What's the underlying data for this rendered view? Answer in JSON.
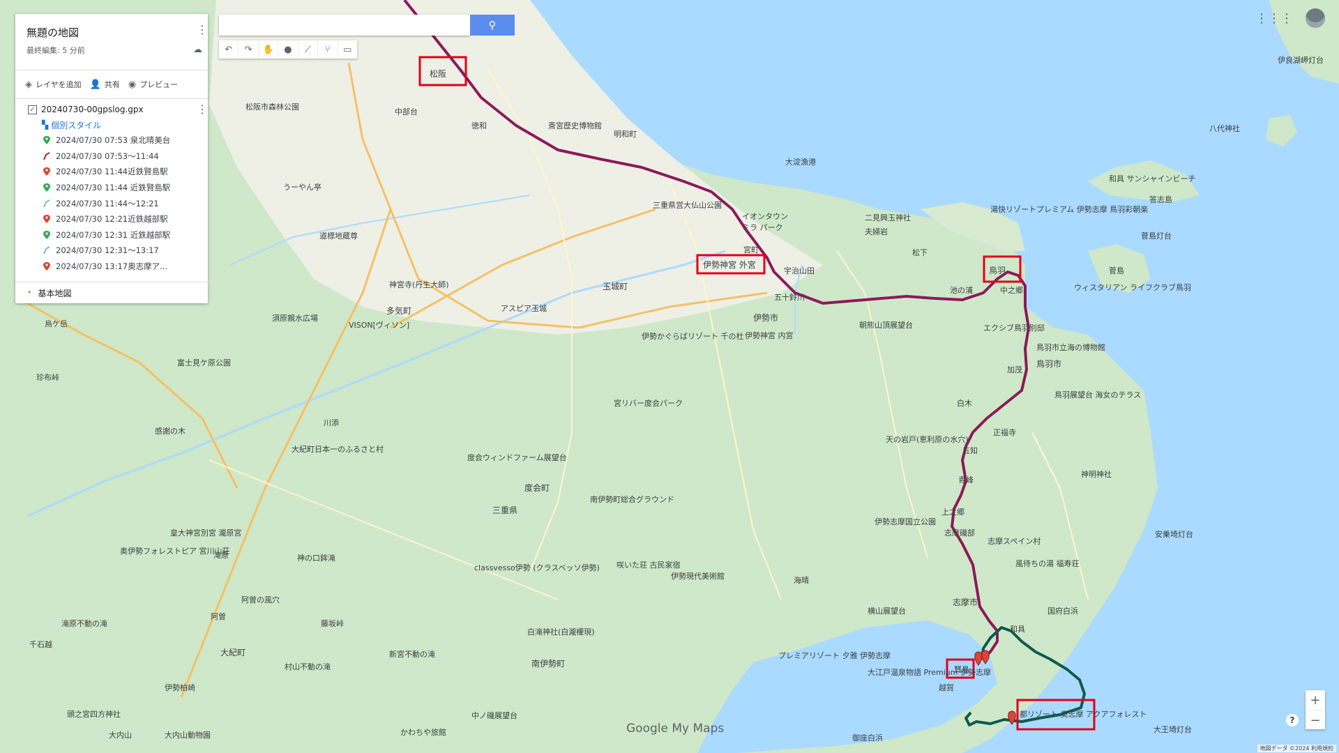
{
  "panel": {
    "title": "無題の地図",
    "subtitle": "最終編集: 5 分前",
    "actions": {
      "add_layer": "レイヤを追加",
      "share": "共有",
      "preview": "プレビュー"
    },
    "layer": {
      "name": "20240730-00gpslog.gpx",
      "style": "個別スタイル",
      "items": [
        {
          "label": "2024/07/30 07:53 泉北晴美台",
          "kind": "point",
          "color": "#34a853"
        },
        {
          "label": "2024/07/30 07:53〜11:44",
          "kind": "line",
          "color": "#a52714"
        },
        {
          "label": "2024/07/30 11:44近鉄賢島駅",
          "kind": "point",
          "color": "#db4437"
        },
        {
          "label": "2024/07/30 11:44 近鉄賢島駅",
          "kind": "point",
          "color": "#34a853"
        },
        {
          "label": "2024/07/30 11:44〜12:21",
          "kind": "line",
          "color": "#7cb4f0"
        },
        {
          "label": "2024/07/30 12:21近鉄越部駅",
          "kind": "point",
          "color": "#db4437"
        },
        {
          "label": "2024/07/30 12:31 近鉄越部駅",
          "kind": "point",
          "color": "#34a853"
        },
        {
          "label": "2024/07/30 12:31〜13:17",
          "kind": "line",
          "color": "#7cb4f0"
        },
        {
          "label": "2024/07/30 13:17奥志摩ア...",
          "kind": "point",
          "color": "#db4437"
        }
      ]
    },
    "base_map": "基本地図"
  },
  "map": {
    "highlight_labels": [
      "松阪",
      "伊勢神宮 外宮",
      "鳥羽",
      "賢島",
      "都リゾート 奥志摩 アクアフォレスト"
    ],
    "places": [
      "松阪",
      "明和町",
      "斎宮歴史博物館",
      "大淀漁港",
      "三重県営大仏山公園",
      "イオンタウン",
      "ミラ パーク",
      "宮町",
      "伊勢市",
      "五十鈴川",
      "伊勢神宮 内宮",
      "玉城町",
      "アスピア玉城",
      "多気町",
      "神宮寺(丹生大師)",
      "VISON[ヴィソン]",
      "須原親水広場",
      "道標地蔵尊",
      "松阪市森林公園",
      "中部台",
      "徳和",
      "うーやん亭",
      "宮リバー度会パーク",
      "度会町",
      "度会ウィンドファーム展望台",
      "三重県",
      "大紀町日本一のふるさと村",
      "川添",
      "感謝の木",
      "富士見ケ原公園",
      "珍布峠",
      "烏ケ岳",
      "奥伊勢フォレストピア 宮川山荘",
      "皇大神宮別宮 瀧原宮",
      "滝原",
      "阿曽",
      "神の口鉾滝",
      "阿曽の風穴",
      "藤坂峠",
      "大紀町",
      "千石越",
      "伊勢柏崎",
      "頭之宮四方神社",
      "大内山",
      "大内山動物園",
      "滝原不動の滝",
      "村山不動の滝",
      "新宮不動の滝",
      "南伊勢町",
      "白滝神社(白瀧權現)",
      "南伊勢町総合グラウンド",
      "伊勢現代美術館",
      "咲いた荘 古民家宿",
      "classvesso伊勢 (クラスベッソ伊勢)",
      "かわちや旅館",
      "中ノ磯展望台",
      "伊勢志摩国立公園",
      "海晴",
      "横山展望台",
      "志摩市",
      "プレミアリゾート 夕雅 伊勢志摩",
      "大江戸温泉物語 Premium 伊勢志摩",
      "賢島",
      "志摩スペイン村",
      "風待ちの湯 福寿荘",
      "国府白浜",
      "大王埼灯台",
      "安乗埼灯台",
      "神明神社",
      "鳥羽展望台 海女のテラス",
      "正福寺",
      "天の岩戸(恵利原の水穴)",
      "鳥羽市",
      "鳥羽市立海の博物館",
      "エクシブ鳥羽別邸",
      "ウィスタリアン ライフクラブ鳥羽",
      "湯快リゾートプレミアム 伊勢志摩 鳥羽彩朝楽",
      "菅島",
      "菅島灯台",
      "答志島",
      "和具 サンシャインビーチ",
      "八代神社",
      "伊良湖岬灯台",
      "二見興玉神社",
      "夫婦岩",
      "朝熊山頂展望台",
      "伊勢かぐらばリゾート 千の杜",
      "宇治山田",
      "松下",
      "池の浦",
      "中之郷",
      "加茂",
      "白木",
      "五知",
      "青峰",
      "上之郷",
      "志摩磯部",
      "御座白浜",
      "和具",
      "越賀"
    ],
    "route_colors": {
      "train": "#8b1a5a",
      "bike": "#0f5a4e"
    }
  },
  "search": {
    "placeholder": ""
  },
  "toolbar": {
    "tools": [
      "undo-icon",
      "redo-icon",
      "hand-icon",
      "marker-icon",
      "line-icon",
      "route-icon",
      "ruler-icon"
    ]
  },
  "branding": {
    "logo": "Google My Maps",
    "attribution": "地図データ ©2024   利用規約"
  },
  "zoom": {
    "in": "+",
    "out": "−"
  },
  "help": "?"
}
